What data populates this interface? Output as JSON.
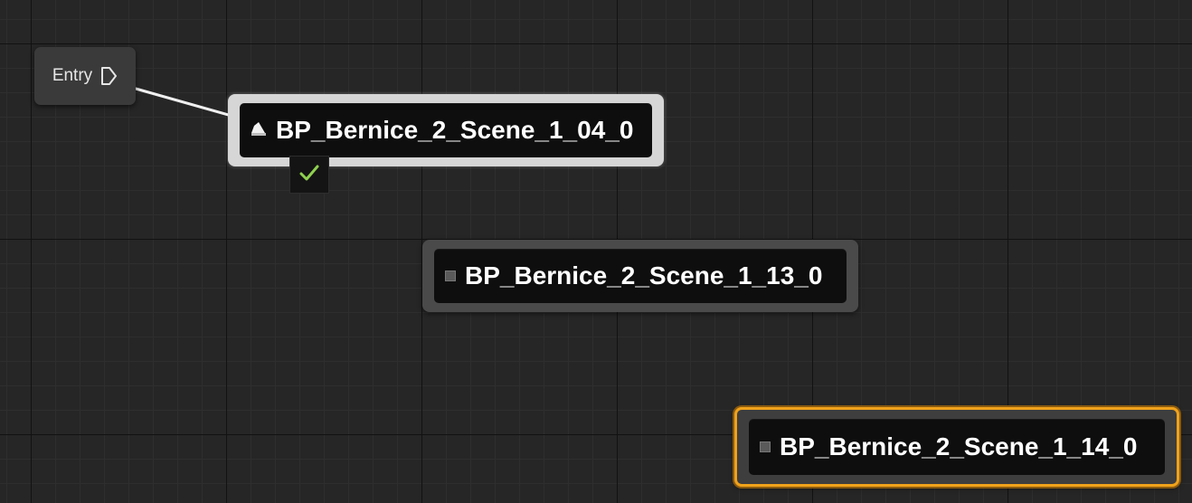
{
  "entry": {
    "label": "Entry"
  },
  "states": [
    {
      "name": "BP_Bernice_2_Scene_1_04_0",
      "status": "active",
      "icon": "sound-icon"
    },
    {
      "name": "BP_Bernice_2_Scene_1_13_0",
      "status": "idle",
      "icon": "state-square-icon"
    },
    {
      "name": "BP_Bernice_2_Scene_1_14_0",
      "status": "selected",
      "icon": "state-square-icon"
    }
  ],
  "colors": {
    "background": "#262626",
    "node_active_border": "#d6d6d6",
    "node_idle_border": "#4a4a4a",
    "selection_outline": "#f0a21b",
    "check": "#8fd14f",
    "wire": "#f0f0f0"
  },
  "transition_icon": "check-icon"
}
